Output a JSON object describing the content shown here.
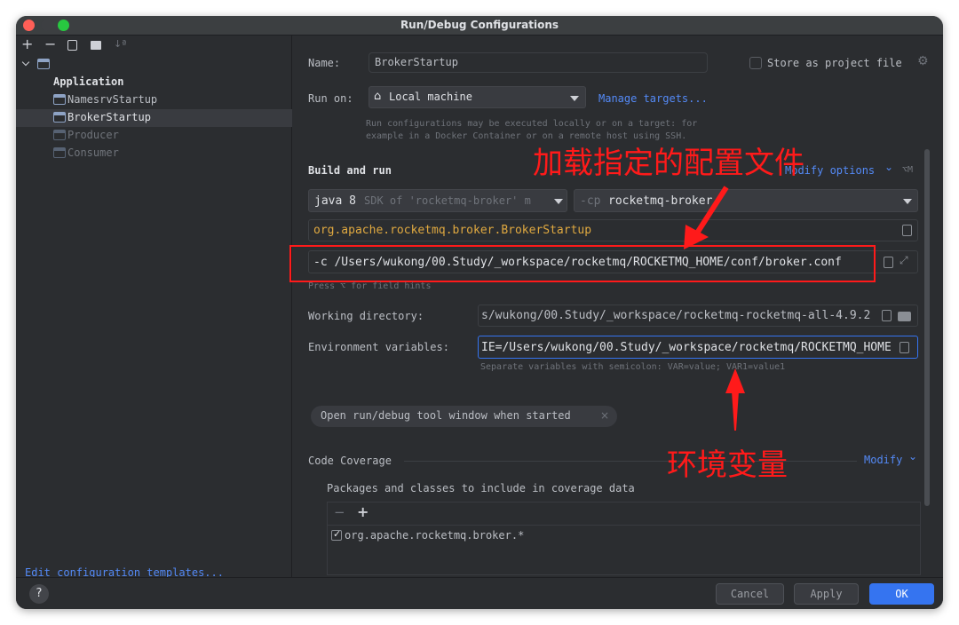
{
  "window": {
    "title": "Run/Debug Configurations"
  },
  "sidebar": {
    "toolbar": {
      "add": "+",
      "remove": "−",
      "sort": "↓ª"
    },
    "root": {
      "label": "Application"
    },
    "items": [
      {
        "label": "NamesrvStartup"
      },
      {
        "label": "BrokerStartup"
      },
      {
        "label": "Producer"
      },
      {
        "label": "Consumer"
      }
    ],
    "edit_templates": "Edit configuration templates..."
  },
  "form": {
    "name_label": "Name:",
    "name_value": "BrokerStartup",
    "store_label": "Store as project file",
    "run_on_label": "Run on:",
    "run_on_value": "Local machine",
    "manage_targets": "Manage targets...",
    "run_on_hint_1": "Run configurations may be executed locally or on a target: for",
    "run_on_hint_2": "example in a Docker Container or on a remote host using SSH.",
    "build_and_run": "Build and run",
    "modify_options": "Modify options",
    "modify_shortcut": "⌥M",
    "jdk_java": "java 8",
    "jdk_sdk": "SDK of 'rocketmq-broker' m",
    "cp_prefix": "-cp",
    "cp_value": "rocketmq-broker",
    "main_class": "org.apache.rocketmq.broker.BrokerStartup",
    "program_args": "-c /Users/wukong/00.Study/_workspace/rocketmq/ROCKETMQ_HOME/conf/broker.conf",
    "field_hint": "Press ⌥ for field hints",
    "workdir_label": "Working directory:",
    "workdir_value": "s/wukong/00.Study/_workspace/rocketmq-rocketmq-all-4.9.2",
    "env_label": "Environment variables:",
    "env_value": "IE=/Users/wukong/00.Study/_workspace/rocketmq/ROCKETMQ_HOME",
    "env_hint": "Separate variables with semicolon: VAR=value; VAR1=value1",
    "open_tool_window": "Open run/debug tool window when started",
    "chip_close": "×",
    "code_coverage": "Code Coverage",
    "modify": "Modify",
    "packages_label": "Packages and classes to include in coverage data",
    "coverage_minus": "−",
    "coverage_plus": "+",
    "coverage_item": "org.apache.rocketmq.broker.*"
  },
  "annotations": {
    "config_file": "加载指定的配置文件",
    "env_vars": "环境变量"
  },
  "footer": {
    "help": "?",
    "cancel": "Cancel",
    "apply": "Apply",
    "ok": "OK"
  },
  "colors": {
    "accent": "#3574f0",
    "annotation": "#ff1a1a",
    "main_class": "#e0a940"
  }
}
